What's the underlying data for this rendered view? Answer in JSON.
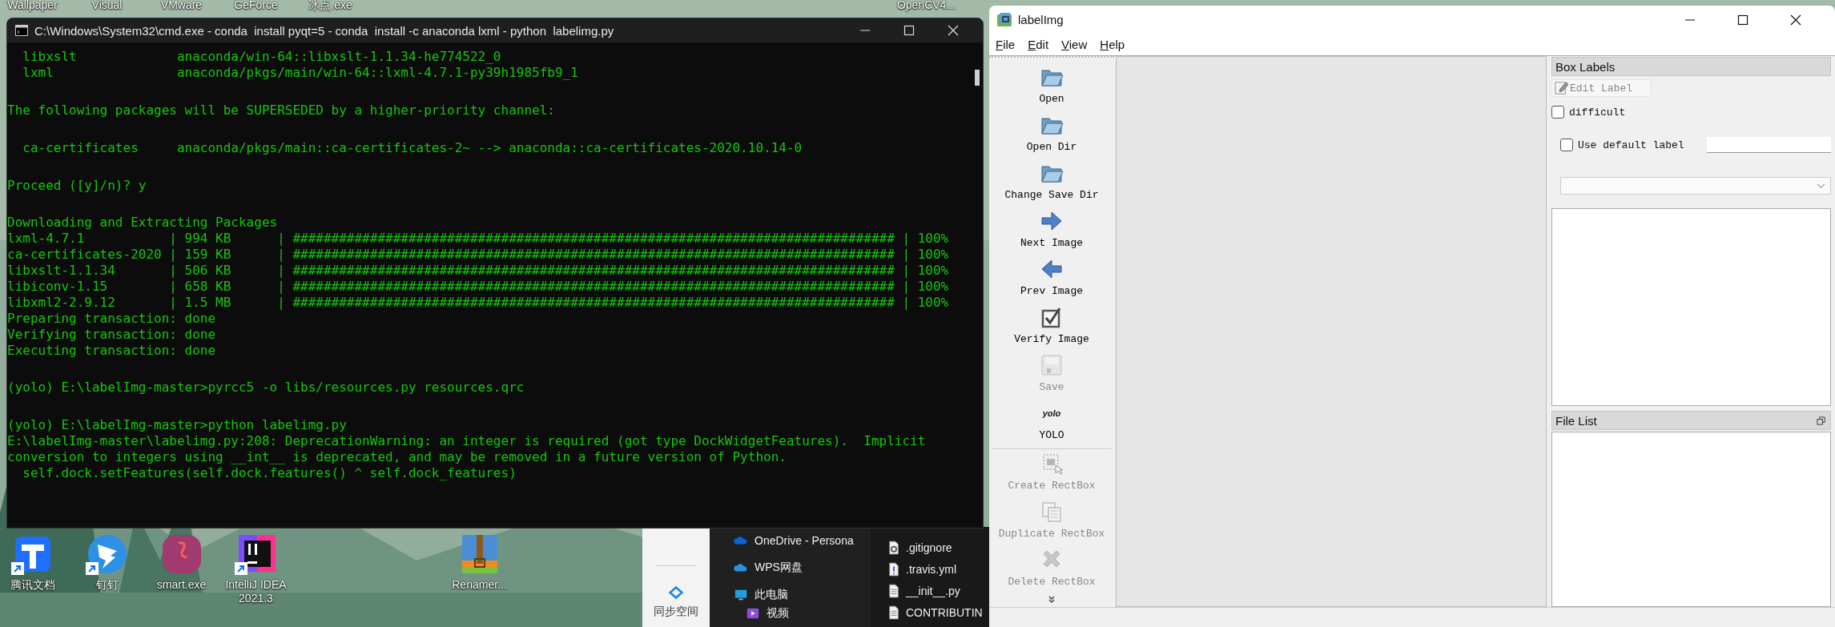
{
  "desktop": {
    "top_icons": [
      {
        "label": "Wallpaper"
      },
      {
        "label": "Visual"
      },
      {
        "label": "VMware"
      },
      {
        "label": "GeForce"
      },
      {
        "label": "冰点.exe"
      },
      {
        "label": "OpenCV4..."
      }
    ],
    "icons": [
      {
        "label": "腾讯文档",
        "kind": "docs",
        "shortcut": true
      },
      {
        "label": "钉钉",
        "kind": "dingtalk",
        "shortcut": true
      },
      {
        "label": "smart.exe",
        "kind": "smart",
        "shortcut": false
      },
      {
        "label": "IntelliJ IDEA 2021.3",
        "kind": "intellij",
        "shortcut": true
      },
      {
        "label": "Renamer...",
        "kind": "archive",
        "shortcut": false
      }
    ]
  },
  "console": {
    "title": "C:\\Windows\\System32\\cmd.exe - conda  install pyqt=5 - conda  install -c anaconda lxml - python  labelimg.py",
    "blocks": [
      {
        "lines": [
          "  libxslt             anaconda/win-64::libxslt-1.1.34-he774522_0",
          "  lxml                anaconda/pkgs/main/win-64::lxml-4.7.1-py39h1985fb9_1"
        ]
      },
      {
        "lines": [
          "The following packages will be SUPERSEDED by a higher-priority channel:"
        ]
      },
      {
        "lines": [
          "  ca-certificates     anaconda/pkgs/main::ca-certificates-2~ --> anaconda::ca-certificates-2020.10.14-0"
        ]
      },
      {
        "lines": [
          "Proceed ([y]/n)? y"
        ]
      },
      {
        "lines": [
          "Downloading and Extracting Packages",
          "lxml-4.7.1           | 994 KB      | ############################################################################## | 100%",
          "ca-certificates-2020 | 159 KB      | ############################################################################## | 100%",
          "libxslt-1.1.34       | 506 KB      | ############################################################################## | 100%",
          "libiconv-1.15        | 658 KB      | ############################################################################## | 100%",
          "libxml2-2.9.12       | 1.5 MB      | ############################################################################## | 100%",
          "Preparing transaction: done",
          "Verifying transaction: done",
          "Executing transaction: done"
        ]
      },
      {
        "lines": [
          "(yolo) E:\\labelImg-master>pyrcc5 -o libs/resources.py resources.qrc"
        ]
      },
      {
        "lines": [
          "(yolo) E:\\labelImg-master>python labelimg.py",
          "E:\\labelImg-master\\labelimg.py:208: DeprecationWarning: an integer is required (got type DockWidgetFeatures).  Implicit",
          "conversion to integers using __int__ is deprecated, and may be removed in a future version of Python.",
          "  self.dock.setFeatures(self.dock.features() ^ self.dock_features)"
        ]
      }
    ]
  },
  "explorer": {
    "sync_label": "同步空间",
    "nav_items": [
      {
        "label": "OneDrive - Persona",
        "kind": "onedrive"
      },
      {
        "label": "WPS网盘",
        "kind": "cloud"
      },
      {
        "label": "此电脑",
        "kind": "pc",
        "children": [
          {
            "label": "视频",
            "kind": "video"
          }
        ]
      }
    ],
    "files": [
      {
        "name": ".gitignore",
        "kind": "config"
      },
      {
        "name": ".travis.yml",
        "kind": "warning"
      },
      {
        "name": "__init__.py",
        "kind": "text"
      },
      {
        "name": "CONTRIBUTIN",
        "kind": "text"
      }
    ]
  },
  "labelimg": {
    "title": "labelImg",
    "menu": [
      {
        "label": "File"
      },
      {
        "label": "Edit"
      },
      {
        "label": "View"
      },
      {
        "label": "Help"
      }
    ],
    "tools": [
      {
        "label": "Open",
        "kind": "folder",
        "disabled": false
      },
      {
        "label": "Open Dir",
        "kind": "folder",
        "disabled": false
      },
      {
        "label": "Change Save Dir",
        "kind": "folder",
        "disabled": false
      },
      {
        "label": "Next Image",
        "kind": "arrow_right",
        "disabled": false
      },
      {
        "label": "Prev Image",
        "kind": "arrow_left",
        "disabled": false
      },
      {
        "label": "Verify Image",
        "kind": "verify",
        "disabled": false
      },
      {
        "label": "Save",
        "kind": "save",
        "disabled": true
      },
      {
        "label": "YOLO",
        "kind": "yolo",
        "icon_text": "yolo",
        "disabled": false
      },
      {
        "label": "Create RectBox",
        "kind": "create",
        "disabled": true,
        "separator_before": true
      },
      {
        "label": "Duplicate RectBox",
        "kind": "duplicate",
        "disabled": true
      },
      {
        "label": "Delete RectBox",
        "kind": "delete",
        "disabled": true
      }
    ],
    "box_labels": {
      "title": "Box Labels",
      "edit_label": {
        "label": "Edit Label",
        "disabled": true
      },
      "difficult": {
        "label": "difficult",
        "checked": false
      },
      "use_default_label": {
        "label": "Use default label",
        "checked": false
      }
    },
    "file_list": {
      "title": "File List"
    }
  }
}
